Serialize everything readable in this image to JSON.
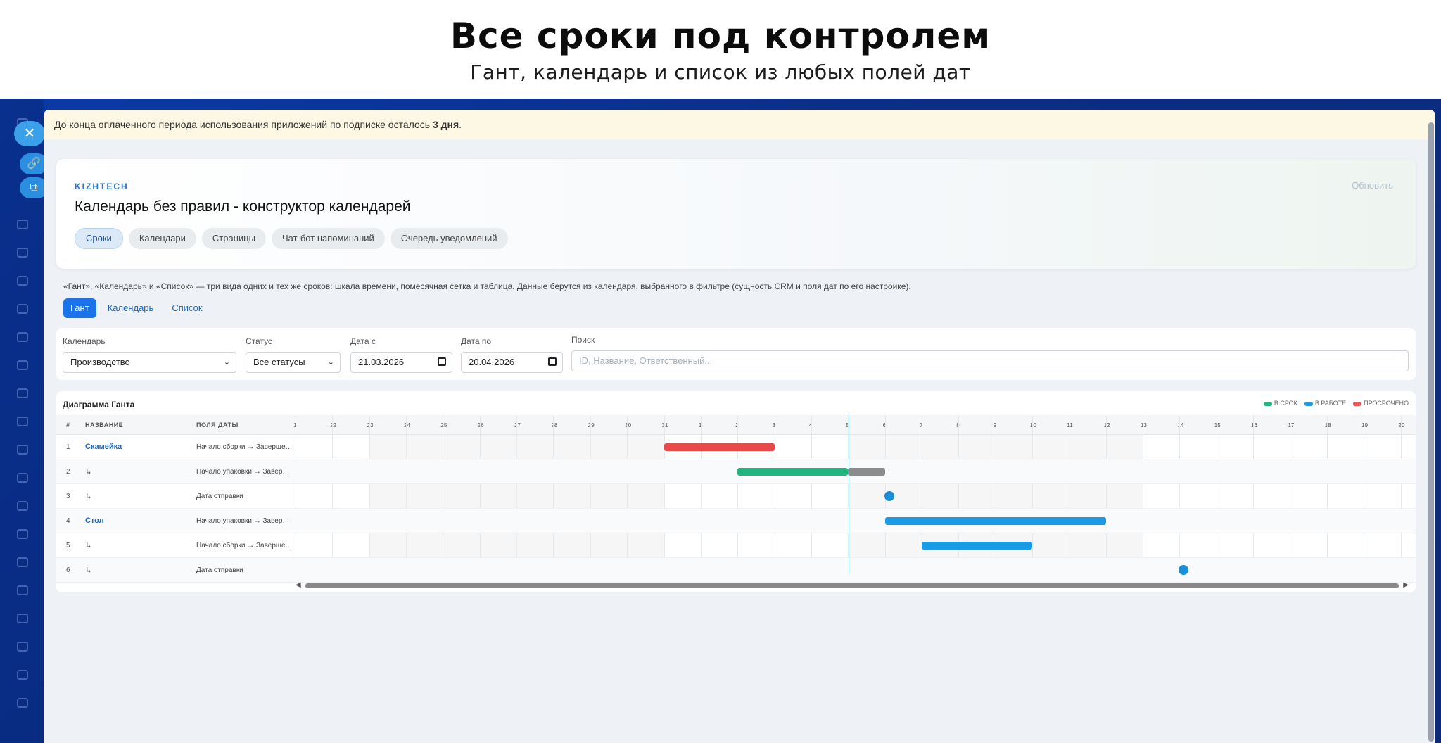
{
  "hero": {
    "title": "Все сроки под контролем",
    "subtitle": "Гант, календарь и список из любых полей дат"
  },
  "notice": {
    "text": "До конца оплаченного периода использования приложений по подписке осталось ",
    "bold": "3 дня",
    "end": "."
  },
  "app": {
    "brand": "KIZHTECH",
    "title": "Календарь без правил - конструктор календарей",
    "refresh": "Обновить",
    "pills": [
      "Сроки",
      "Календари",
      "Страницы",
      "Чат-бот напоминаний",
      "Очередь уведомлений"
    ]
  },
  "description": "«Гант», «Календарь» и «Список» — три вида одних и тех же сроков: шкала времени, помесячная сетка и таблица. Данные берутся из календаря, выбранного в фильтре (сущность CRM и поля дат по его настройке).",
  "view_tabs": [
    "Гант",
    "Календарь",
    "Список"
  ],
  "filters": {
    "calendar_label": "Календарь",
    "calendar_value": "Производство",
    "status_label": "Статус",
    "status_value": "Все статусы",
    "date_from_label": "Дата с",
    "date_from_value": "21.03.2026",
    "date_to_label": "Дата по",
    "date_to_value": "20.04.2026",
    "search_label": "Поиск",
    "search_placeholder": "ID, Название, Ответственный..."
  },
  "gantt": {
    "title": "Диаграмма Ганта",
    "legend": [
      {
        "label": "В СРОК",
        "color": "#1fb57f"
      },
      {
        "label": "В РАБОТЕ",
        "color": "#1a9be6"
      },
      {
        "label": "ПРОСРОЧЕНО",
        "color": "#ef5350"
      }
    ],
    "columns": [
      "#",
      "НАЗВАНИЕ",
      "ПОЛЯ ДАТЫ"
    ],
    "days": [
      "1",
      "22",
      "23",
      "24",
      "25",
      "26",
      "27",
      "28",
      "29",
      "30",
      "31",
      "1",
      "2",
      "3",
      "4",
      "5",
      "6",
      "7",
      "8",
      "9",
      "10",
      "11",
      "12",
      "13",
      "14",
      "15",
      "16",
      "17",
      "18",
      "19",
      "20"
    ],
    "rows": [
      {
        "num": "1",
        "name": "Скамейка",
        "link": true,
        "fields": "Начало сборки → Завершение сборки"
      },
      {
        "num": "2",
        "name": "↳",
        "link": false,
        "fields": "Начало упаковки → Завершение упаковки"
      },
      {
        "num": "3",
        "name": "↳",
        "link": false,
        "fields": "Дата отправки"
      },
      {
        "num": "4",
        "name": "Стол",
        "link": true,
        "fields": "Начало упаковки → Завершение упаковки"
      },
      {
        "num": "5",
        "name": "↳",
        "link": false,
        "fields": "Начало сборки → Завершение сборки"
      },
      {
        "num": "6",
        "name": "↳",
        "link": false,
        "fields": "Дата отправки"
      }
    ]
  }
}
